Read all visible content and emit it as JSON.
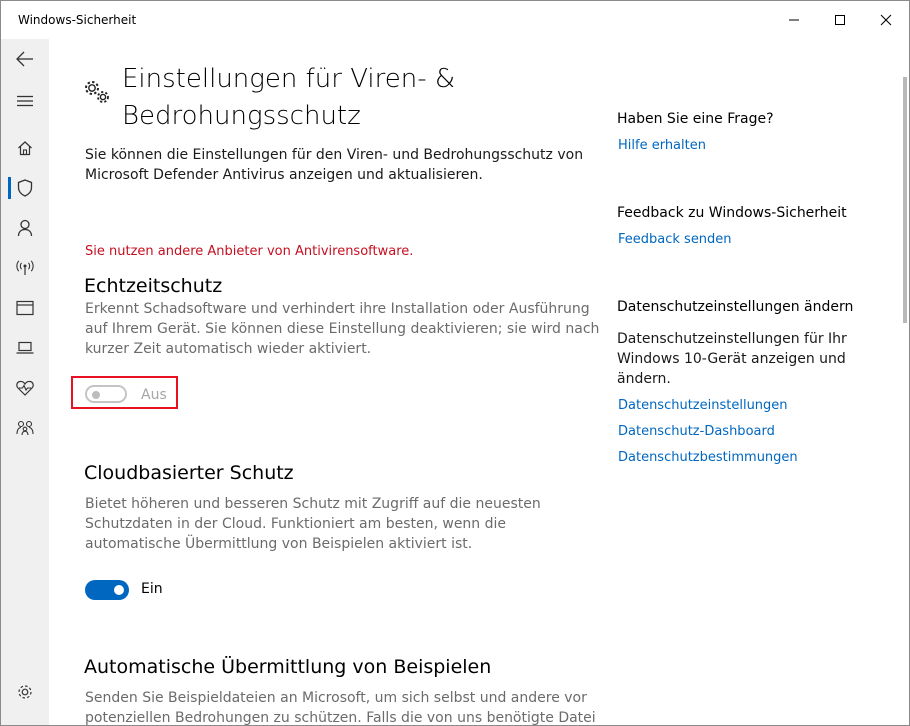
{
  "window": {
    "title": "Windows-Sicherheit",
    "buttons": [
      "minimize",
      "maximize",
      "close"
    ]
  },
  "sidebar": {
    "items": [
      {
        "icon": "back-arrow-icon"
      },
      {
        "icon": "hamburger-menu-icon"
      },
      {
        "icon": "home-icon"
      },
      {
        "icon": "shield-icon",
        "active": true
      },
      {
        "icon": "account-icon"
      },
      {
        "icon": "wireless-antenna-icon"
      },
      {
        "icon": "app-browser-icon"
      },
      {
        "icon": "laptop-icon"
      },
      {
        "icon": "heart-pulse-icon"
      },
      {
        "icon": "family-icon"
      },
      {
        "icon": "settings-gear-icon"
      }
    ]
  },
  "main": {
    "title_line1": "Einstellungen für Viren- &",
    "title_line2": "Bedrohungsschutz",
    "intro_line1": "Sie können die Einstellungen für den Viren- und Bedrohungsschutz von",
    "intro_line2": "Microsoft Defender Antivirus anzeigen und aktualisieren.",
    "warning": "Sie nutzen andere Anbieter von Antivirensoftware.",
    "sections": [
      {
        "heading": "Echtzeitschutz",
        "desc_line1": "Erkennt Schadsoftware und verhindert ihre Installation oder Ausführung",
        "desc_line2": "auf Ihrem Gerät. Sie können diese Einstellung deaktivieren; sie wird nach",
        "desc_line3": "kurzer Zeit automatisch wieder aktiviert.",
        "toggle_state": "off",
        "toggle_label": "Aus"
      },
      {
        "heading": "Cloudbasierter Schutz",
        "desc_line1": "Bietet höheren und besseren Schutz mit Zugriff auf die neuesten",
        "desc_line2": "Schutzdaten in der Cloud. Funktioniert am besten, wenn die",
        "desc_line3": "automatische Übermittlung von Beispielen aktiviert ist.",
        "toggle_state": "on",
        "toggle_label": "Ein"
      },
      {
        "heading": "Automatische Übermittlung von Beispielen",
        "desc_line1": "Senden Sie Beispieldateien an Microsoft, um sich selbst und andere vor",
        "desc_line2": "potenziellen Bedrohungen zu schützen. Falls die von uns benötigte Datei"
      }
    ]
  },
  "right_panel": {
    "question_heading": "Haben Sie eine Frage?",
    "help_link": "Hilfe erhalten",
    "feedback_heading": "Feedback zu Windows-Sicherheit",
    "feedback_link": "Feedback senden",
    "privacy_heading": "Datenschutzeinstellungen ändern",
    "privacy_line1": "Datenschutzeinstellungen für Ihr",
    "privacy_line2": "Windows 10-Gerät anzeigen und",
    "privacy_line3": "ändern.",
    "privacy_links": [
      "Datenschutzeinstellungen",
      "Datenschutz-Dashboard",
      "Datenschutzbestimmungen"
    ]
  },
  "colors": {
    "accent": "#0067c0",
    "warning": "#c50f1f",
    "highlight_border": "#e81123",
    "sidebar_bg": "#f0f0f0"
  }
}
